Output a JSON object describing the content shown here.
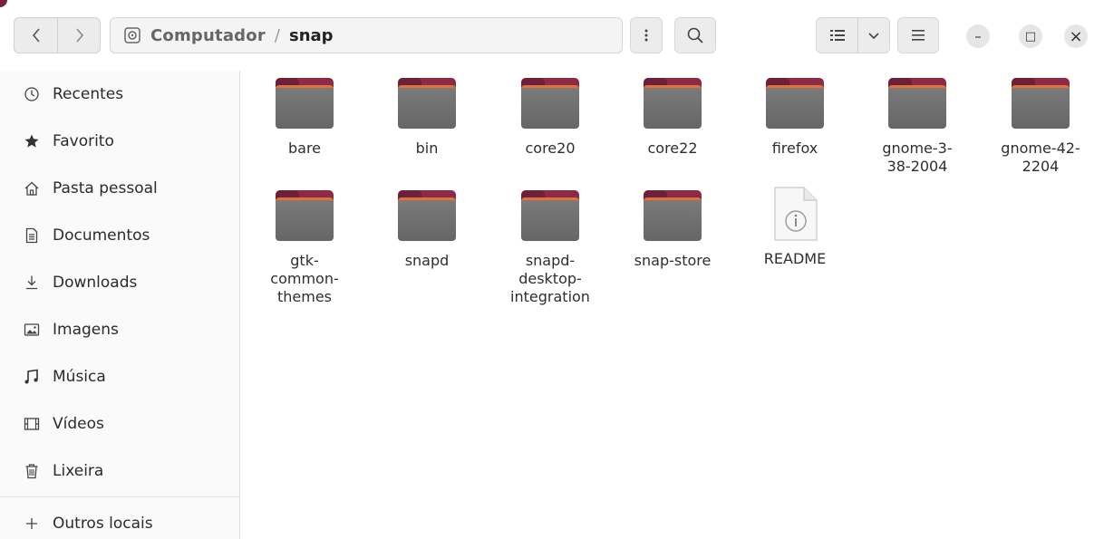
{
  "header": {
    "back_icon": "chevron-left-icon",
    "forward_icon": "chevron-right-icon",
    "path": {
      "root_label": "Computador",
      "separator": "/",
      "current": "snap"
    },
    "path_menu_icon": "vertical-dots-icon",
    "search_icon": "search-icon",
    "view_icon": "list-view-icon",
    "view_dropdown_icon": "chevron-down-icon",
    "main_menu_icon": "hamburger-menu-icon",
    "window_controls": {
      "minimize": "–",
      "maximize": "□",
      "close": "×"
    }
  },
  "sidebar": {
    "items": [
      {
        "label": "Recentes",
        "icon": "clock-icon"
      },
      {
        "label": "Favorito",
        "icon": "star-icon"
      },
      {
        "label": "Pasta pessoal",
        "icon": "home-icon"
      },
      {
        "label": "Documentos",
        "icon": "document-icon"
      },
      {
        "label": "Downloads",
        "icon": "download-icon"
      },
      {
        "label": "Imagens",
        "icon": "image-icon"
      },
      {
        "label": "Música",
        "icon": "music-icon"
      },
      {
        "label": "Vídeos",
        "icon": "video-icon"
      },
      {
        "label": "Lixeira",
        "icon": "trash-icon"
      }
    ],
    "other_locations": {
      "label": "Outros locais",
      "icon": "plus-icon"
    }
  },
  "files": [
    {
      "name": "bare",
      "type": "folder"
    },
    {
      "name": "bin",
      "type": "folder"
    },
    {
      "name": "core20",
      "type": "folder"
    },
    {
      "name": "core22",
      "type": "folder"
    },
    {
      "name": "firefox",
      "type": "folder"
    },
    {
      "name": "gnome-3-38-2004",
      "display": "gnome-3-\n38-2004",
      "type": "folder"
    },
    {
      "name": "gnome-42-2204",
      "display": "gnome-42-\n2204",
      "type": "folder"
    },
    {
      "name": "gtk-common-themes",
      "display": "gtk-\ncommon-\nthemes",
      "type": "folder"
    },
    {
      "name": "snapd",
      "type": "folder"
    },
    {
      "name": "snapd-desktop-integration",
      "display": "snapd-\ndesktop-\nintegration",
      "type": "folder"
    },
    {
      "name": "snap-store",
      "type": "folder"
    },
    {
      "name": "README",
      "type": "file"
    }
  ],
  "colors": {
    "folder_back": "#8c2a47",
    "folder_front": "#6f6f6f",
    "folder_accent": "#e0713a"
  }
}
